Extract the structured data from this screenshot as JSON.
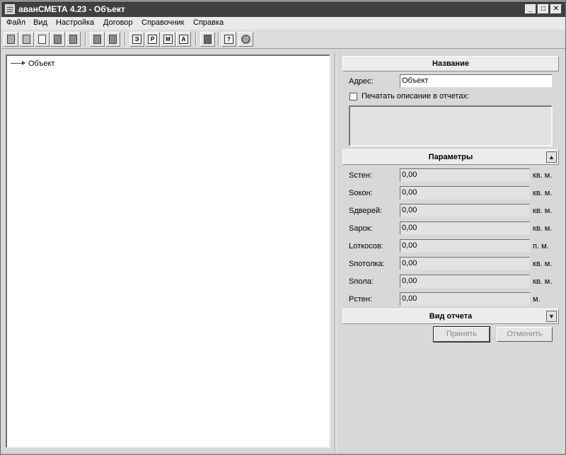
{
  "window": {
    "title": "аванСМЕТА 4.23 - Объект",
    "minimize_label": "_",
    "maximize_label": "□",
    "close_label": "✕"
  },
  "menu": [
    "Файл",
    "Вид",
    "Настройка",
    "Договор",
    "Справочник",
    "Справка"
  ],
  "toolbar": {
    "letter_buttons": [
      "Э",
      "Р",
      "М",
      "А"
    ],
    "help_label": "?",
    "about_label": "@"
  },
  "tree": {
    "root_label": "Объект"
  },
  "name_section": {
    "header": "Название",
    "address_label": "Адрес:",
    "address_value": "Объект",
    "print_description_label": "Печатать описание в отчетах:",
    "print_description_checked": false
  },
  "params_section": {
    "header": "Параметры",
    "collapse_icon": "▲",
    "rows": [
      {
        "label": "Sстен:",
        "value": "0,00",
        "unit": "кв. м."
      },
      {
        "label": "Sокон:",
        "value": "0,00",
        "unit": "кв. м."
      },
      {
        "label": "Sдверей:",
        "value": "0,00",
        "unit": "кв. м."
      },
      {
        "label": "Sарок:",
        "value": "0,00",
        "unit": "кв. м."
      },
      {
        "label": "Lоткосов:",
        "value": "0,00",
        "unit": "п. м."
      },
      {
        "label": "Sпотолка:",
        "value": "0,00",
        "unit": "кв. м."
      },
      {
        "label": "Sпола:",
        "value": "0,00",
        "unit": "кв. м."
      },
      {
        "label": "Pстен:",
        "value": "0,00",
        "unit": "м."
      }
    ]
  },
  "report_section": {
    "header": "Вид отчета",
    "expand_icon": "▼"
  },
  "actions": {
    "accept_label": "Принять",
    "cancel_label": "Отменить"
  }
}
